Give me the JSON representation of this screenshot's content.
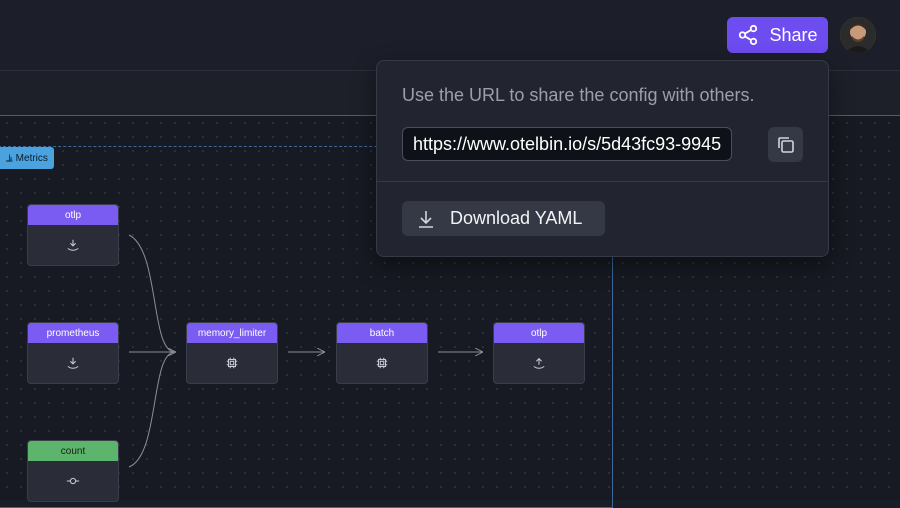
{
  "header": {
    "share_label": "Share",
    "accent_color": "#6d4cf0"
  },
  "pipeline": {
    "tag_label": "Metrics",
    "nodes": {
      "otlp_in": {
        "label": "otlp",
        "icon": "receiver-icon"
      },
      "prometheus": {
        "label": "prometheus",
        "icon": "receiver-icon"
      },
      "count": {
        "label": "count",
        "icon": "connector-icon"
      },
      "memory_limiter": {
        "label": "memory_limiter",
        "icon": "processor-icon"
      },
      "batch": {
        "label": "batch",
        "icon": "processor-icon"
      },
      "otlp_out": {
        "label": "otlp",
        "icon": "exporter-icon"
      }
    }
  },
  "share_popover": {
    "description": "Use the URL to share the config with others.",
    "url_value": "https://www.otelbin.io/s/5d43fc93-9945",
    "copy_icon": "copy-icon",
    "download_label": "Download YAML",
    "download_icon": "download-icon"
  }
}
